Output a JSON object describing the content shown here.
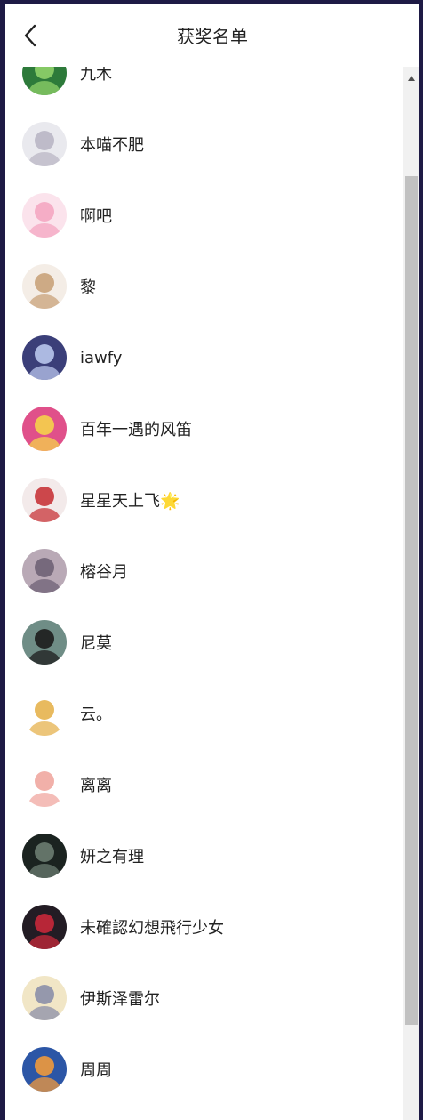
{
  "header": {
    "title": "获奖名单",
    "back_icon": "chevron-left-icon"
  },
  "winners": [
    {
      "name": "九木",
      "avatar_bg": "#2d7a3a",
      "avatar_fg": "#8fd16a"
    },
    {
      "name": "本喵不肥",
      "avatar_bg": "#e9e9ee",
      "avatar_fg": "#b9b6c4"
    },
    {
      "name": "啊吧",
      "avatar_bg": "#fbe3ec",
      "avatar_fg": "#f4a6c2"
    },
    {
      "name": "黎",
      "avatar_bg": "#f4ede6",
      "avatar_fg": "#c9a27a"
    },
    {
      "name": "iawfy",
      "avatar_bg": "#3b3f79",
      "avatar_fg": "#b9c6ec"
    },
    {
      "name": "百年一遇的风笛",
      "avatar_bg": "#e0508a",
      "avatar_fg": "#f5d24a"
    },
    {
      "name": "星星天上飞🌟",
      "avatar_bg": "#f3eaea",
      "avatar_fg": "#c8353a"
    },
    {
      "name": "榕谷月",
      "avatar_bg": "#b9a9b6",
      "avatar_fg": "#6f6276"
    },
    {
      "name": "尼莫",
      "avatar_bg": "#6f8d86",
      "avatar_fg": "#1c1c1c"
    },
    {
      "name": "云。",
      "avatar_bg": "#ffffff",
      "avatar_fg": "#e6b24e"
    },
    {
      "name": "离离",
      "avatar_bg": "#ffffff",
      "avatar_fg": "#f0a7a0"
    },
    {
      "name": "妍之有理",
      "avatar_bg": "#1b2320",
      "avatar_fg": "#6b7c70"
    },
    {
      "name": "未確認幻想飛行少女",
      "avatar_bg": "#231c24",
      "avatar_fg": "#c8283a"
    },
    {
      "name": "伊斯泽雷尔",
      "avatar_bg": "#f1e6c6",
      "avatar_fg": "#8b8fa8"
    },
    {
      "name": "周周",
      "avatar_bg": "#2c56a6",
      "avatar_fg": "#f09a3c"
    }
  ],
  "scrollbar": {
    "up_icon": "arrow-up-icon"
  }
}
